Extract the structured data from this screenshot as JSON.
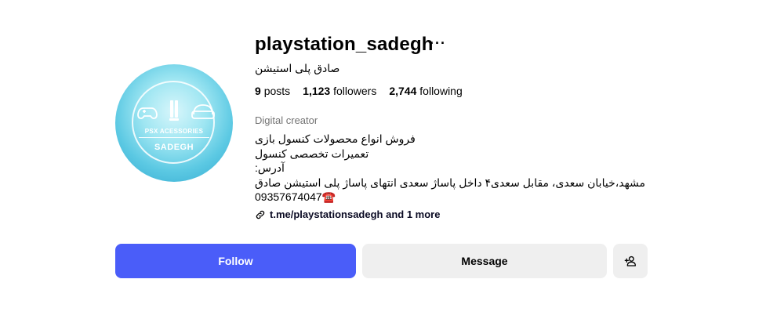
{
  "profile": {
    "username": "playstation_sadegh",
    "more_label": "···",
    "full_name": "صادق پلی استیشن",
    "avatar": {
      "line1": "PSX ACESSORIES",
      "line2": "SADEGH",
      "icons": [
        "gamepad-icon",
        "ps5-console-icon",
        "vr-headset-icon"
      ]
    },
    "stats": {
      "posts_count": "9",
      "posts_label": "posts",
      "followers_count": "1,123",
      "followers_label": "followers",
      "following_count": "2,744",
      "following_label": "following"
    },
    "category": "Digital creator",
    "bio": {
      "line1": "فروش انواع محصولات کنسول بازی",
      "line2": "تعمیرات تخصصی کنسول",
      "line3": "آدرس:",
      "line4": "مشهد،خیابان سعدی، مقابل سعدی۴ داخل پاساژ سعدی انتهای پاساژ پلی استیشن صادق",
      "line5": "09357674047☎️"
    },
    "link": {
      "text": "t.me/playstationsadegh and 1 more",
      "icon": "link-icon"
    }
  },
  "actions": {
    "follow_label": "Follow",
    "message_label": "Message",
    "suggest_icon": "add-person-icon"
  },
  "colors": {
    "follow_bg": "#4a5df9",
    "secondary_bg": "#efefef",
    "muted_text": "#737373"
  }
}
